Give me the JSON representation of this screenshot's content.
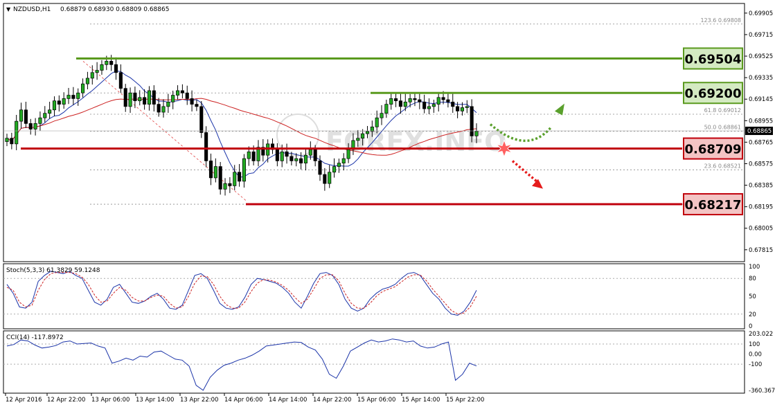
{
  "chart_data": {
    "type": "candlestick",
    "symbol": "NZDUSD,H1",
    "ohlc_header": "0.68879 0.68930 0.68809 0.68865",
    "watermark": "FOREX.INFO",
    "price_axis": {
      "range": [
        0.6771,
        0.6899
      ],
      "ticks": [
        "0.69095",
        "0.69085",
        "0.68965",
        "0.68955",
        "0.68945",
        "0.68935",
        "0.68925",
        "0.68915",
        "0.68905",
        "0.68895",
        "0.68885",
        "0.68875",
        "0.68865",
        "0.68855",
        "0.68845",
        "0.68835",
        "0.68825",
        "0.68815",
        "0.68805",
        "0.68795",
        "0.68785",
        "0.68775",
        "0.68765",
        "0.68755",
        "0.68745",
        "0.68735"
      ],
      "tick_labels": [
        "0.69905",
        "0.69715",
        "0.69525",
        "0.69335",
        "0.69145",
        "0.68955",
        "0.68765",
        "0.68575",
        "0.68385",
        "0.68195",
        "0.68005",
        "0.67815"
      ],
      "tick_values": [
        0.69905,
        0.69715,
        0.69525,
        0.69335,
        0.69145,
        0.68955,
        0.68765,
        0.68575,
        0.68385,
        0.68195,
        0.68005,
        0.67815
      ],
      "current_price": "0.68865",
      "current_price_value": 0.68865
    },
    "time_axis": [
      "12 Apr 2016",
      "12 Apr 22:00",
      "13 Apr 06:00",
      "13 Apr 14:00",
      "13 Apr 22:00",
      "14 Apr 06:00",
      "14 Apr 14:00",
      "14 Apr 22:00",
      "15 Apr 06:00",
      "15 Apr 14:00",
      "15 Apr 22:00"
    ],
    "levels": [
      {
        "label": "0.69504",
        "value": 0.69504,
        "kind": "resistance",
        "color": "#5a9a1e"
      },
      {
        "label": "0.69200",
        "value": 0.692,
        "kind": "resistance",
        "color": "#5a9a1e"
      },
      {
        "label": "0.68709",
        "value": 0.68709,
        "kind": "support",
        "color": "#c0000c"
      },
      {
        "label": "0.68217",
        "value": 0.68217,
        "kind": "support",
        "color": "#c0000c"
      }
    ],
    "fibonacci": [
      {
        "label": "123.6  0.69808",
        "value": 0.69808
      },
      {
        "label": "61.8  0.69012",
        "value": 0.69012
      },
      {
        "label": "50.0  0.68861",
        "value": 0.68861
      },
      {
        "label": "23.6  0.68521",
        "value": 0.68521
      }
    ],
    "extra_gridlines": [
      0.692,
      0.69012,
      0.68861,
      0.68521,
      0.68217
    ],
    "candles_close": [
      0.688,
      0.6875,
      0.6895,
      0.6905,
      0.6893,
      0.6888,
      0.6893,
      0.6898,
      0.6902,
      0.6905,
      0.6913,
      0.691,
      0.6915,
      0.6918,
      0.6915,
      0.692,
      0.6928,
      0.6933,
      0.6938,
      0.694,
      0.6945,
      0.6948,
      0.6945,
      0.6938,
      0.6924,
      0.6908,
      0.692,
      0.6913,
      0.6916,
      0.691,
      0.6922,
      0.691,
      0.6903,
      0.6908,
      0.6912,
      0.6918,
      0.6922,
      0.692,
      0.6915,
      0.691,
      0.6908,
      0.6885,
      0.686,
      0.6845,
      0.6855,
      0.6835,
      0.684,
      0.6838,
      0.685,
      0.6842,
      0.6862,
      0.6868,
      0.686,
      0.6872,
      0.6865,
      0.6875,
      0.687,
      0.686,
      0.6868,
      0.6864,
      0.686,
      0.6862,
      0.6858,
      0.6865,
      0.687,
      0.686,
      0.6848,
      0.684,
      0.685,
      0.6855,
      0.6858,
      0.6862,
      0.687,
      0.6878,
      0.688,
      0.6884,
      0.6886,
      0.689,
      0.6898,
      0.6902,
      0.691,
      0.6915,
      0.6913,
      0.6908,
      0.6912,
      0.6915,
      0.6914,
      0.6912,
      0.6906,
      0.6908,
      0.691,
      0.6916,
      0.6914,
      0.6912,
      0.6908,
      0.6904,
      0.6907,
      0.6908,
      0.6882,
      0.6886
    ],
    "stoch": {
      "label": "Stoch(5,3,3) 61.3829 59.1248",
      "ticks": [
        100,
        80,
        50,
        20,
        0
      ],
      "main": [
        70,
        55,
        32,
        30,
        40,
        75,
        85,
        92,
        90,
        88,
        92,
        85,
        80,
        60,
        40,
        35,
        45,
        65,
        70,
        55,
        40,
        38,
        42,
        50,
        55,
        45,
        30,
        28,
        35,
        60,
        85,
        88,
        80,
        60,
        38,
        30,
        28,
        32,
        48,
        70,
        80,
        78,
        75,
        72,
        65,
        55,
        40,
        30,
        50,
        72,
        88,
        90,
        85,
        70,
        45,
        30,
        25,
        30,
        45,
        55,
        62,
        65,
        70,
        80,
        88,
        90,
        85,
        70,
        55,
        45,
        30,
        20,
        18,
        25,
        40,
        60
      ],
      "signal": [
        65,
        60,
        40,
        32,
        35,
        60,
        78,
        88,
        90,
        90,
        90,
        88,
        82,
        70,
        52,
        40,
        42,
        55,
        65,
        60,
        48,
        42,
        42,
        48,
        52,
        50,
        38,
        30,
        32,
        50,
        72,
        84,
        83,
        70,
        50,
        36,
        30,
        30,
        40,
        58,
        72,
        78,
        77,
        74,
        68,
        60,
        48,
        38,
        45,
        62,
        80,
        86,
        86,
        76,
        55,
        38,
        30,
        30,
        38,
        50,
        58,
        62,
        66,
        74,
        82,
        86,
        86,
        76,
        62,
        50,
        38,
        26,
        20,
        22,
        32,
        50
      ]
    },
    "cci": {
      "label": "CCI(14) -117.8972",
      "ticks": [
        "203.022",
        "100",
        "0.00",
        "-100",
        "-360.3677"
      ],
      "tick_values": [
        203.022,
        100,
        0,
        -100,
        -360.3677
      ],
      "values": [
        80,
        95,
        140,
        130,
        90,
        60,
        70,
        85,
        120,
        130,
        100,
        105,
        110,
        80,
        60,
        -90,
        -70,
        -40,
        -60,
        -20,
        -30,
        20,
        30,
        -10,
        -50,
        -60,
        -120,
        -310,
        -360,
        -230,
        -160,
        -110,
        -90,
        -60,
        -40,
        -10,
        30,
        80,
        90,
        100,
        110,
        120,
        115,
        70,
        40,
        -50,
        -200,
        -240,
        -120,
        30,
        70,
        110,
        140,
        120,
        130,
        150,
        140,
        120,
        130,
        80,
        60,
        70,
        100,
        120,
        -260,
        -200,
        -90,
        -118
      ]
    },
    "annotations": {
      "bullish_arrow_color": "#5aa02c",
      "bearish_arrow_color": "#e51c1c",
      "ma_colors": {
        "fast": "#1a33a8",
        "slow": "#cc2020"
      }
    }
  }
}
